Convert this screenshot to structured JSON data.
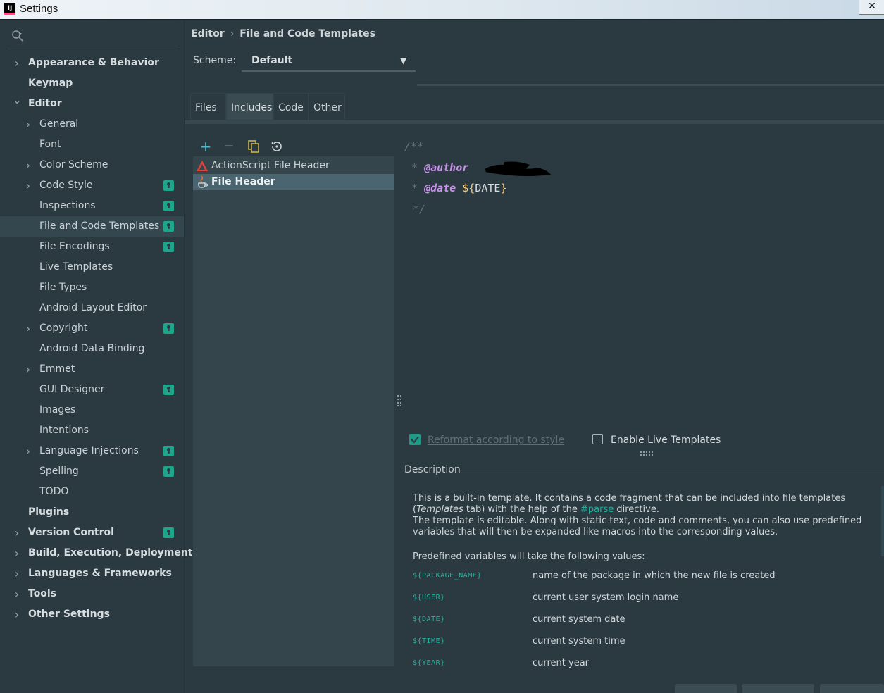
{
  "window": {
    "title": "Settings",
    "app_icon": "intellij-icon",
    "close": "✕"
  },
  "sidebar": {
    "search_icon": "search-icon",
    "items": [
      {
        "label": "Appearance & Behavior",
        "level": 0,
        "bold": true,
        "chevron": "right",
        "project": false
      },
      {
        "label": "Keymap",
        "level": 0,
        "bold": true,
        "chevron": "",
        "project": false
      },
      {
        "label": "Editor",
        "level": 0,
        "bold": true,
        "chevron": "down",
        "project": false
      },
      {
        "label": "General",
        "level": 1,
        "bold": false,
        "chevron": "right",
        "project": false
      },
      {
        "label": "Font",
        "level": 1,
        "bold": false,
        "chevron": "",
        "project": false
      },
      {
        "label": "Color Scheme",
        "level": 1,
        "bold": false,
        "chevron": "right",
        "project": false
      },
      {
        "label": "Code Style",
        "level": 1,
        "bold": false,
        "chevron": "right",
        "project": true
      },
      {
        "label": "Inspections",
        "level": 1,
        "bold": false,
        "chevron": "",
        "project": true
      },
      {
        "label": "File and Code Templates",
        "level": 1,
        "bold": false,
        "chevron": "",
        "project": true,
        "selected": true
      },
      {
        "label": "File Encodings",
        "level": 1,
        "bold": false,
        "chevron": "",
        "project": true
      },
      {
        "label": "Live Templates",
        "level": 1,
        "bold": false,
        "chevron": "",
        "project": false
      },
      {
        "label": "File Types",
        "level": 1,
        "bold": false,
        "chevron": "",
        "project": false
      },
      {
        "label": "Android Layout Editor",
        "level": 1,
        "bold": false,
        "chevron": "",
        "project": false
      },
      {
        "label": "Copyright",
        "level": 1,
        "bold": false,
        "chevron": "right",
        "project": true
      },
      {
        "label": "Android Data Binding",
        "level": 1,
        "bold": false,
        "chevron": "",
        "project": false
      },
      {
        "label": "Emmet",
        "level": 1,
        "bold": false,
        "chevron": "right",
        "project": false
      },
      {
        "label": "GUI Designer",
        "level": 1,
        "bold": false,
        "chevron": "",
        "project": true
      },
      {
        "label": "Images",
        "level": 1,
        "bold": false,
        "chevron": "",
        "project": false
      },
      {
        "label": "Intentions",
        "level": 1,
        "bold": false,
        "chevron": "",
        "project": false
      },
      {
        "label": "Language Injections",
        "level": 1,
        "bold": false,
        "chevron": "right",
        "project": true
      },
      {
        "label": "Spelling",
        "level": 1,
        "bold": false,
        "chevron": "",
        "project": true
      },
      {
        "label": "TODO",
        "level": 1,
        "bold": false,
        "chevron": "",
        "project": false
      },
      {
        "label": "Plugins",
        "level": 0,
        "bold": true,
        "chevron": "",
        "project": false
      },
      {
        "label": "Version Control",
        "level": 0,
        "bold": true,
        "chevron": "right",
        "project": true
      },
      {
        "label": "Build, Execution, Deployment",
        "level": 0,
        "bold": true,
        "chevron": "right",
        "project": false
      },
      {
        "label": "Languages & Frameworks",
        "level": 0,
        "bold": true,
        "chevron": "right",
        "project": false
      },
      {
        "label": "Tools",
        "level": 0,
        "bold": true,
        "chevron": "right",
        "project": false
      },
      {
        "label": "Other Settings",
        "level": 0,
        "bold": true,
        "chevron": "right",
        "project": false
      }
    ]
  },
  "breadcrumb": {
    "parent": "Editor",
    "separator": "›",
    "current": "File and Code Templates"
  },
  "scheme": {
    "label": "Scheme:",
    "value": "Default",
    "arrow": "▼"
  },
  "tabs": [
    {
      "label": "Files",
      "active": false
    },
    {
      "label": "Includes",
      "active": true
    },
    {
      "label": "Code",
      "active": false
    },
    {
      "label": "Other",
      "active": false
    }
  ],
  "toolbar": {
    "add": "+",
    "remove": "−",
    "copy_icon": "copy-icon",
    "reset_icon": "reset-icon"
  },
  "templates": [
    {
      "label": "ActionScript File Header",
      "icon": "actionscript-icon",
      "selected": false
    },
    {
      "label": "File Header",
      "icon": "java-icon",
      "selected": true
    }
  ],
  "editor": {
    "line1": "/**",
    "line2_prefix": "* ",
    "line2_tag": "@author",
    "line3_prefix": "* ",
    "line3_tag": "@date",
    "line3_var_open": "${",
    "line3_var_name": "DATE",
    "line3_var_close": "}",
    "line4": "*/"
  },
  "options": {
    "reformat_label": "Reformat according to style",
    "reformat_checked": true,
    "live_label": "Enable Live Templates",
    "live_checked": false
  },
  "description": {
    "title": "Description",
    "p1_a": "This is a built-in template. It contains a code fragment that can be included into file templates",
    "p1_b_open": "(",
    "p1_b_italic": "Templates",
    "p1_b_mid": " tab) with the help of the ",
    "p1_b_hash": "#parse",
    "p1_b_end": " directive.",
    "p2": "The template is editable. Along with static text, code and comments, you can also use predefined variables that will then be expanded like macros into the corresponding values.",
    "predef": "Predefined variables will take the following values:",
    "variables": [
      {
        "name": "${PACKAGE_NAME}",
        "desc": "name of the package in which the new file is created"
      },
      {
        "name": "${USER}",
        "desc": "current user system login name"
      },
      {
        "name": "${DATE}",
        "desc": "current system date"
      },
      {
        "name": "${TIME}",
        "desc": "current system time"
      },
      {
        "name": "${YEAR}",
        "desc": "current year"
      }
    ]
  }
}
